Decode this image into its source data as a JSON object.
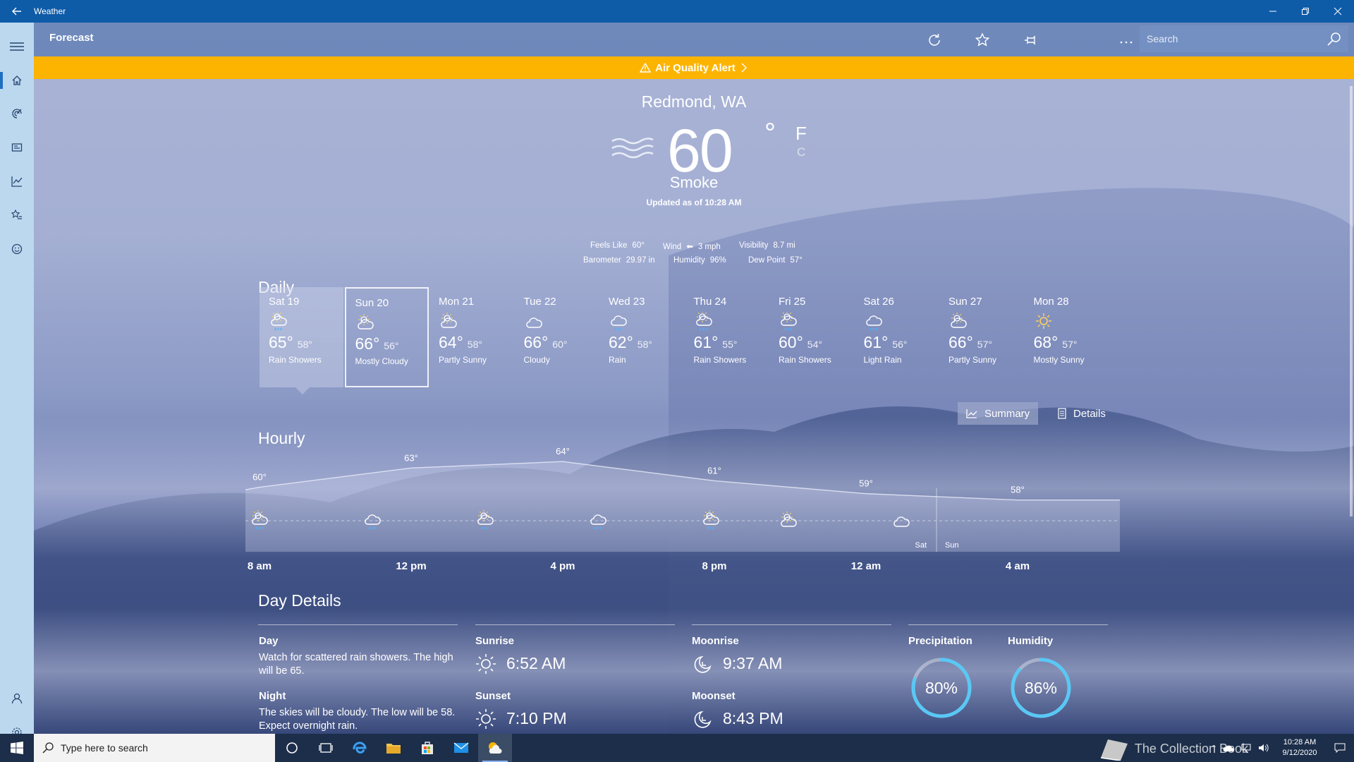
{
  "window": {
    "title": "Weather"
  },
  "nav": {
    "items": [
      "home-icon",
      "radar-icon",
      "news-icon",
      "historical-weather-icon",
      "favorites-icon",
      "life-icon"
    ],
    "bottom": [
      "account-icon",
      "settings-icon"
    ]
  },
  "toolbar": {
    "title": "Forecast",
    "search_placeholder": "Search"
  },
  "alert": {
    "label": "Air Quality Alert"
  },
  "current": {
    "location": "Redmond, WA",
    "temp": "60",
    "deg": "°",
    "unit_f": "F",
    "unit_c": "C",
    "condition": "Smoke",
    "updated": "Updated as of 10:28 AM",
    "feels_label": "Feels Like",
    "feels": "60°",
    "wind_label": "Wind",
    "wind": "3 mph",
    "visibility_label": "Visibility",
    "visibility": "8.7 mi",
    "barometer_label": "Barometer",
    "barometer": "29.97 in",
    "humidity_label": "Humidity",
    "humidity": "96%",
    "dew_label": "Dew Point",
    "dew": "57°"
  },
  "daily": {
    "heading": "Daily",
    "days": [
      {
        "day": "Sat 19",
        "hi": "65°",
        "lo": "58°",
        "cond": "Rain Showers",
        "icon": "sun-rain"
      },
      {
        "day": "Sun 20",
        "hi": "66°",
        "lo": "56°",
        "cond": "Mostly Cloudy",
        "icon": "cloud-sun"
      },
      {
        "day": "Mon 21",
        "hi": "64°",
        "lo": "58°",
        "cond": "Partly Sunny",
        "icon": "cloud-sun"
      },
      {
        "day": "Tue 22",
        "hi": "66°",
        "lo": "60°",
        "cond": "Cloudy",
        "icon": "cloud"
      },
      {
        "day": "Wed 23",
        "hi": "62°",
        "lo": "58°",
        "cond": "Rain",
        "icon": "rain"
      },
      {
        "day": "Thu 24",
        "hi": "61°",
        "lo": "55°",
        "cond": "Rain Showers",
        "icon": "sun-rain"
      },
      {
        "day": "Fri 25",
        "hi": "60°",
        "lo": "54°",
        "cond": "Rain Showers",
        "icon": "sun-rain"
      },
      {
        "day": "Sat 26",
        "hi": "61°",
        "lo": "56°",
        "cond": "Light Rain",
        "icon": "rain"
      },
      {
        "day": "Sun 27",
        "hi": "66°",
        "lo": "57°",
        "cond": "Partly Sunny",
        "icon": "cloud-sun"
      },
      {
        "day": "Mon 28",
        "hi": "68°",
        "lo": "57°",
        "cond": "Mostly Sunny",
        "icon": "sun"
      }
    ]
  },
  "hourly": {
    "heading": "Hourly",
    "summary_label": "Summary",
    "details_label": "Details",
    "times": [
      "8 am",
      "12 pm",
      "4 pm",
      "8 pm",
      "12 am",
      "4 am"
    ],
    "day_left": "Sat",
    "day_right": "Sun",
    "chart_data": {
      "type": "area",
      "x": [
        "8 am",
        "12 pm",
        "4 pm",
        "8 pm",
        "12 am",
        "4 am"
      ],
      "temps": [
        {
          "t": "8 am",
          "v": 60
        },
        {
          "t": "12 pm",
          "v": 63
        },
        {
          "t": "4 pm",
          "v": 64
        },
        {
          "t": "8 pm",
          "v": 61
        },
        {
          "t": "12 am",
          "v": 59
        },
        {
          "t": "4 am",
          "v": 58
        }
      ],
      "labels": [
        "60°",
        "63°",
        "64°",
        "61°",
        "59°",
        "58°"
      ],
      "icons": [
        "sun-rain",
        "rain",
        "sun-rain",
        "rain",
        "sun-rain",
        "cloud-sun",
        "cloud"
      ]
    }
  },
  "details": {
    "heading": "Day Details",
    "day_label": "Day",
    "day_text": "Watch for scattered rain showers. The high will be 65.",
    "night_label": "Night",
    "night_text": "The skies will be cloudy. The low will be 58. Expect overnight rain.",
    "sunrise_label": "Sunrise",
    "sunrise": "6:52 AM",
    "sunset_label": "Sunset",
    "sunset": "7:10 PM",
    "moonrise_label": "Moonrise",
    "moonrise": "9:37 AM",
    "moonset_label": "Moonset",
    "moonset": "8:43 PM",
    "precip_label": "Precipitation",
    "precip": "80%",
    "precip_frac": 0.8,
    "humid_label": "Humidity",
    "humid": "86%",
    "humid_frac": 0.86
  },
  "taskbar": {
    "search_placeholder": "Type here to search",
    "time": "10:28 AM",
    "date": "9/12/2020",
    "watermark": "The Collection Book"
  }
}
